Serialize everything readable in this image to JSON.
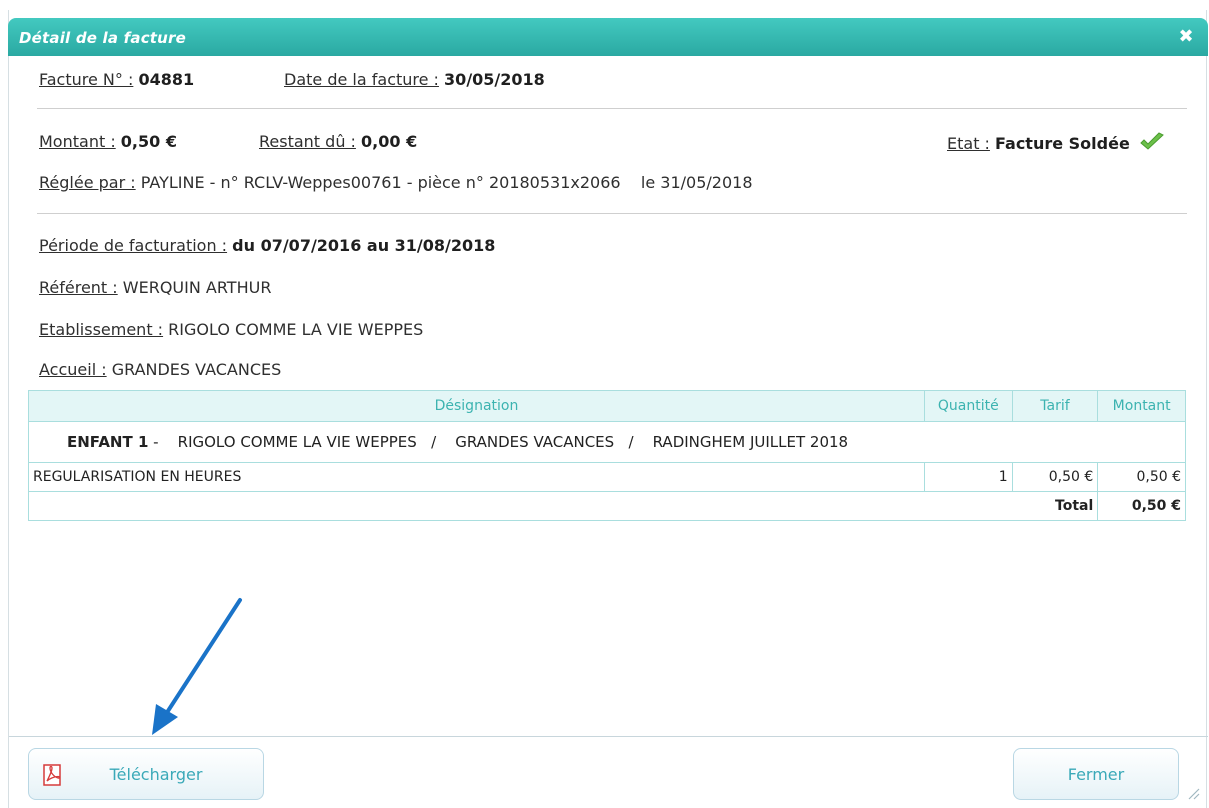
{
  "dialog": {
    "title": "Détail de la facture",
    "close_glyph": "✖"
  },
  "invoice": {
    "number_label": "Facture N° :",
    "number": "04881",
    "date_label": "Date de la facture :",
    "date": "30/05/2018",
    "amount_label": "Montant :",
    "amount": "0,50 €",
    "remaining_label": "Restant dû :",
    "remaining": "0,00 €",
    "state_label": "Etat :",
    "state": "Facture Soldée",
    "paid_by_label": "Réglée par :",
    "paid_by": "PAYLINE - n° RCLV-Weppes00761 - pièce n° 20180531x2066    le 31/05/2018",
    "period_label": "Période de facturation :",
    "period": "du 07/07/2016 au 31/08/2018",
    "referent_label": "Référent :",
    "referent": "WERQUIN ARTHUR",
    "establishment_label": "Etablissement :",
    "establishment": "RIGOLO COMME LA VIE WEPPES",
    "reception_label": "Accueil :",
    "reception": "GRANDES VACANCES"
  },
  "table": {
    "headers": [
      "Désignation",
      "Quantité",
      "Tarif",
      "Montant"
    ],
    "group": {
      "child": "ENFANT 1",
      "detail": " -    RIGOLO COMME LA VIE WEPPES   /    GRANDES VACANCES   /    RADINGHEM JUILLET 2018"
    },
    "rows": [
      {
        "designation": "REGULARISATION EN HEURES",
        "quantity": "1",
        "rate": "0,50 €",
        "amount": "0,50 €"
      }
    ],
    "total_label": "Total",
    "total": "0,50 €"
  },
  "buttons": {
    "download": "Télécharger",
    "close": "Fermer"
  },
  "colors": {
    "title_bar": "#2aa9a2",
    "header_text": "#3cb3b0",
    "arrow": "#1a73c8",
    "check": "#5cb85c"
  },
  "icons": {
    "download": "pdf-icon",
    "state": "check-icon",
    "close": "close-icon"
  }
}
